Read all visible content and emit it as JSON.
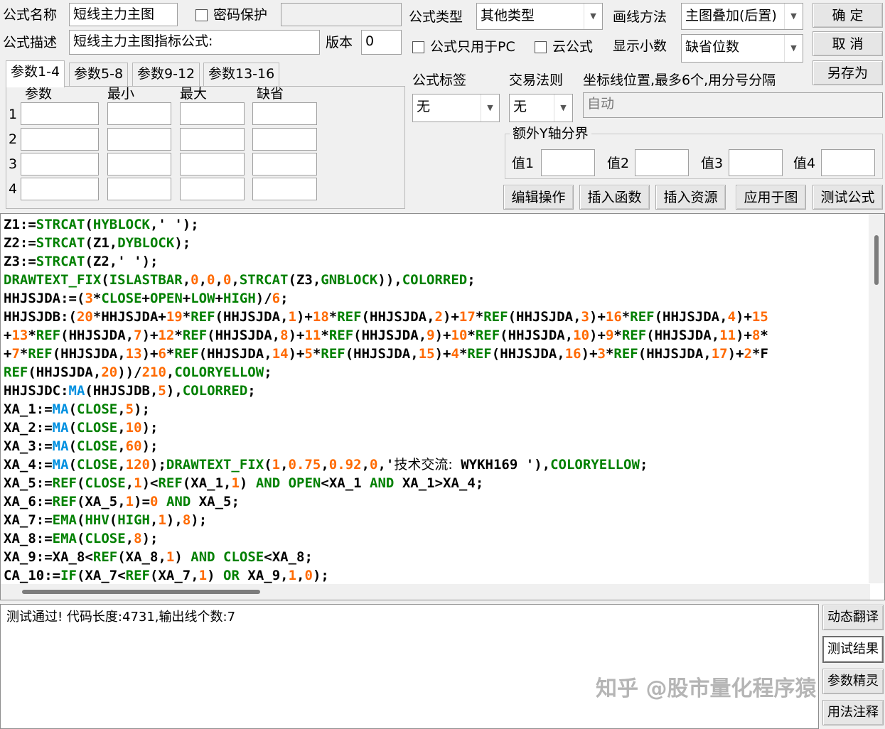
{
  "header": {
    "name_label": "公式名称",
    "name_value": "短线主力主图",
    "password_label": "密码保护",
    "desc_label": "公式描述",
    "desc_value": "短线主力主图指标公式:",
    "version_label": "版本",
    "version_value": "0",
    "type_label": "公式类型",
    "type_value": "其他类型",
    "draw_label": "画线方法",
    "draw_value": "主图叠加(后置)",
    "pc_only_label": "公式只用于PC",
    "cloud_label": "云公式",
    "decimal_label": "显示小数",
    "decimal_value": "缺省位数",
    "tag_label": "公式标签",
    "tag_value": "无",
    "trade_label": "交易法则",
    "trade_value": "无",
    "axis_label": "坐标线位置,最多6个,用分号分隔",
    "axis_placeholder": "自动"
  },
  "buttons": {
    "ok": "确  定",
    "cancel": "取  消",
    "save_as": "另存为",
    "edit": "编辑操作",
    "insert_func": "插入函数",
    "insert_res": "插入资源",
    "apply": "应用于图",
    "test": "测试公式"
  },
  "tabs": [
    "参数1-4",
    "参数5-8",
    "参数9-12",
    "参数13-16"
  ],
  "params": {
    "col_param": "参数",
    "col_min": "最小",
    "col_max": "最大",
    "col_default": "缺省",
    "rows": [
      "1",
      "2",
      "3",
      "4"
    ]
  },
  "yaxis": {
    "title": "额外Y轴分界",
    "v1": "值1",
    "v2": "值2",
    "v3": "值3",
    "v4": "值4"
  },
  "code_lines": [
    "Z1:=STRCAT(HYBLOCK,' ');",
    "Z2:=STRCAT(Z1,DYBLOCK);",
    "Z3:=STRCAT(Z2,' ');",
    "DRAWTEXT_FIX(ISLASTBAR,0,0,0,STRCAT(Z3,GNBLOCK)),COLORRED;",
    "HHJSJDA:=(3*CLOSE+OPEN+LOW+HIGH)/6;",
    "HHJSJDB:(20*HHJSJDA+19*REF(HHJSJDA,1)+18*REF(HHJSJDA,2)+17*REF(HHJSJDA,3)+16*REF(HHJSJDA,4)+15",
    "+13*REF(HHJSJDA,7)+12*REF(HHJSJDA,8)+11*REF(HHJSJDA,9)+10*REF(HHJSJDA,10)+9*REF(HHJSJDA,11)+8*",
    "+7*REF(HHJSJDA,13)+6*REF(HHJSJDA,14)+5*REF(HHJSJDA,15)+4*REF(HHJSJDA,16)+3*REF(HHJSJDA,17)+2*F",
    "REF(HHJSJDA,20))/210,COLORYELLOW;",
    "HHJSJDC:MA(HHJSJDB,5),COLORRED;",
    "XA_1:=MA(CLOSE,5);",
    "XA_2:=MA(CLOSE,10);",
    "XA_3:=MA(CLOSE,60);",
    "XA_4:=MA(CLOSE,120);DRAWTEXT_FIX(1,0.75,0.92,0,'技术交流: WYKH169 '),COLORYELLOW;",
    "XA_5:=REF(CLOSE,1)<REF(XA_1,1) AND OPEN<XA_1 AND XA_1>XA_4;",
    "XA_6:=REF(XA_5,1)=0 AND XA_5;",
    "XA_7:=EMA(HHV(HIGH,1),8);",
    "XA_8:=EMA(CLOSE,8);",
    "XA_9:=XA_8<REF(XA_8,1) AND CLOSE<XA_8;",
    "CA_10:=IF(XA_7<REF(XA_7,1) OR XA_9,1,0);"
  ],
  "result": {
    "text": "测试通过! 代码长度:4731,输出线个数:7"
  },
  "side_buttons": {
    "dyn": "动态翻译",
    "res": "测试结果",
    "wiz": "参数精灵",
    "usage": "用法注释"
  },
  "watermark": "知乎 @股市量化程序猿",
  "colors": {
    "keyword": "#008000",
    "number": "#ff6a00",
    "function": "#0090e0"
  }
}
